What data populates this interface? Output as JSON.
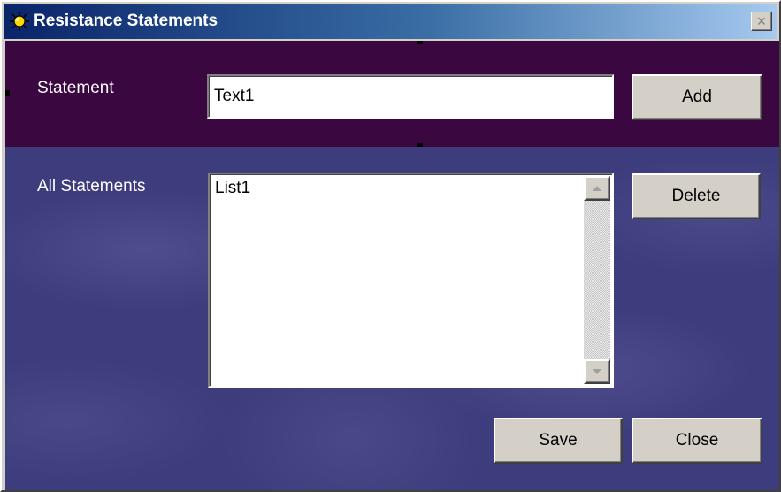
{
  "window": {
    "title": "Resistance Statements",
    "close_glyph": "×"
  },
  "statement": {
    "label": "Statement",
    "input_value": "Text1",
    "add_label": "Add"
  },
  "all_statements": {
    "label": "All Statements",
    "items": [
      "List1"
    ],
    "delete_label": "Delete"
  },
  "footer": {
    "save_label": "Save",
    "close_label": "Close"
  },
  "icons": {
    "title": "sun-icon",
    "scroll_up": "arrow-up-icon",
    "scroll_down": "arrow-down-icon"
  },
  "colors": {
    "title_start": "#0a246a",
    "title_end": "#a6caf0",
    "top_panel": "#3a0741",
    "bottom_panel": "#3d3d7d",
    "face": "#d4d0c8"
  }
}
